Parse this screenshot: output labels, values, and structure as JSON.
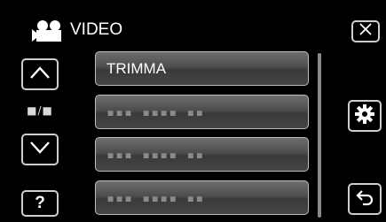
{
  "header": {
    "title": "VIDEO",
    "icon": "video-camera-icon"
  },
  "buttons": {
    "close": {
      "icon": "close-icon",
      "glyph": "✕"
    },
    "up": {
      "icon": "chevron-up-icon"
    },
    "down": {
      "icon": "chevron-down-icon"
    },
    "help": {
      "icon": "help-icon",
      "glyph": "?"
    },
    "settings": {
      "icon": "gear-icon"
    },
    "back": {
      "icon": "back-arrow-icon"
    }
  },
  "page_indicator": "■/■",
  "items": [
    {
      "label": "TRIMMA"
    },
    {
      "label": "▪▪▪ ▪▪▪▪ ▪▪"
    },
    {
      "label": "▪▪▪ ▪▪▪▪ ▪▪"
    },
    {
      "label": "▪▪▪ ▪▪▪▪ ▪▪"
    }
  ],
  "colors": {
    "background": "#000000",
    "item_gradient_top": "#6e6e6e",
    "item_gradient_bottom": "#3a3a3a",
    "border": "#cfcfcf"
  }
}
